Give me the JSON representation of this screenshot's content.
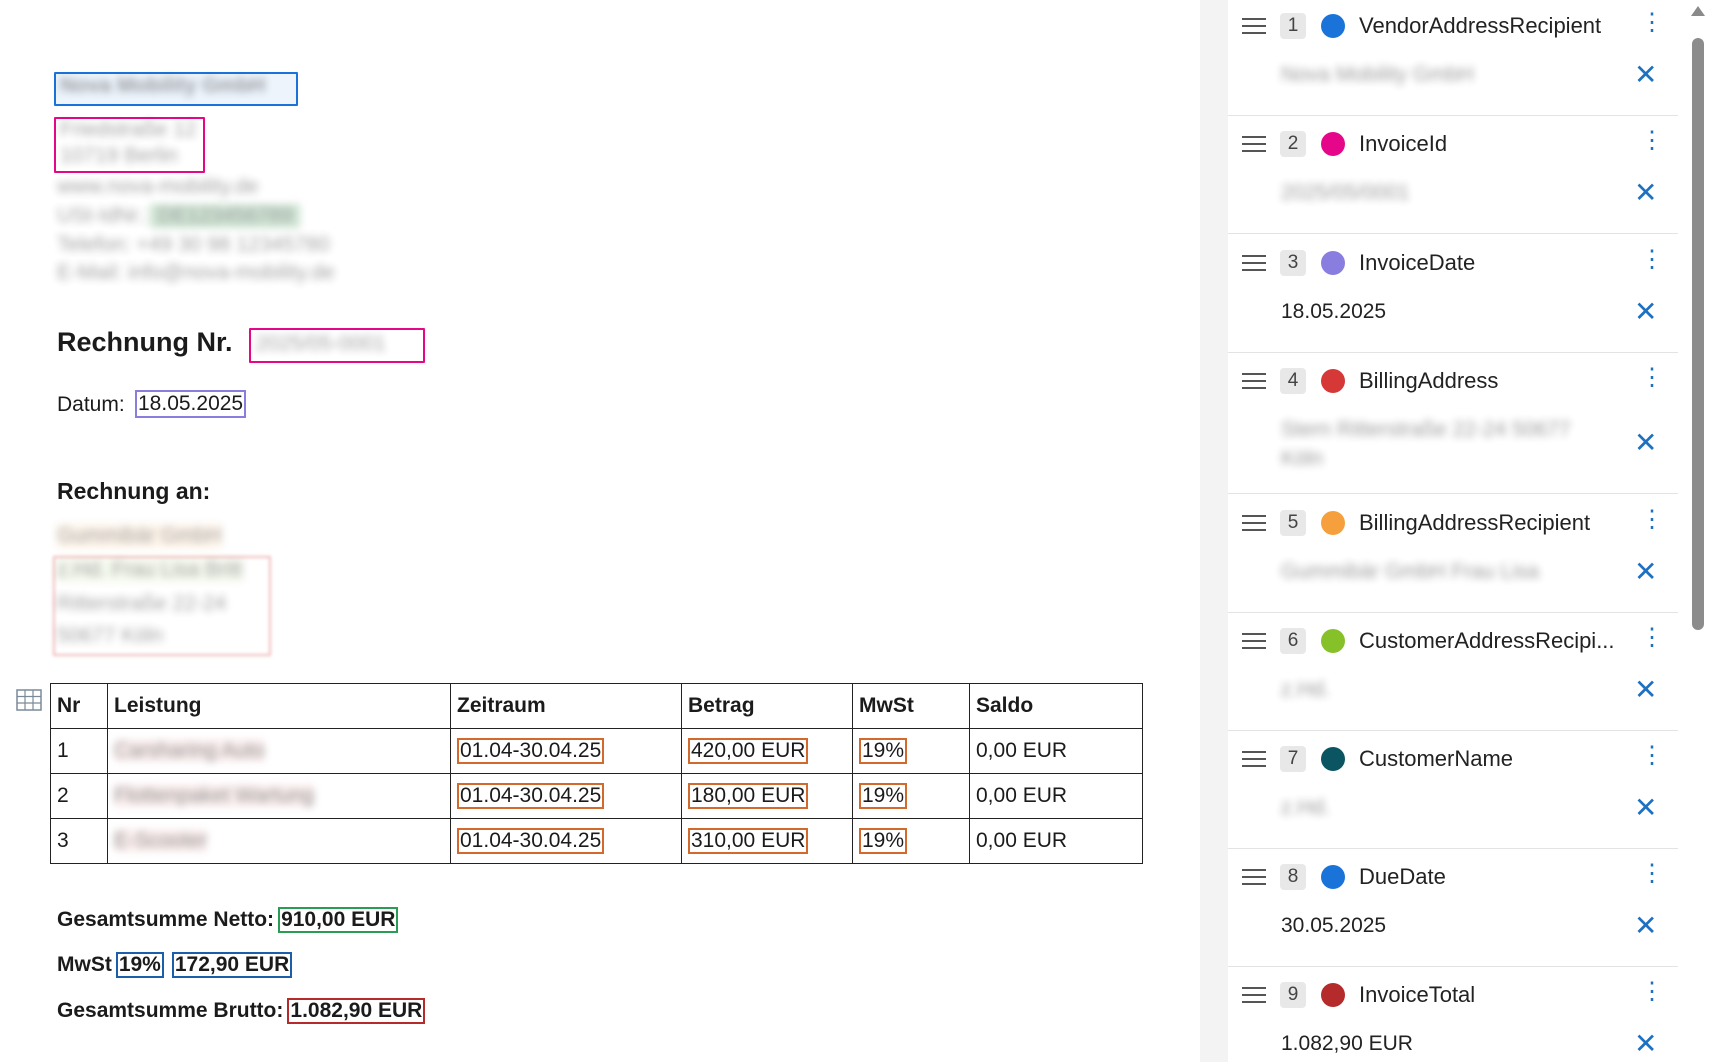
{
  "document": {
    "vendor_name": "Nova Mobility GmbH",
    "vendor_street": "Friedstraße 12",
    "vendor_city": "10719 Berlin",
    "vendor_web": "www.nova-mobility.de",
    "vendor_vat_label": "USt-IdNr.:",
    "vendor_vat": "DE123456789",
    "vendor_phone": "Telefon: +49 30 98 12345780",
    "vendor_email": "E-Mail: info@nova-mobility.de",
    "title": "Rechnung Nr.",
    "invoice_number": "2025/05-0001",
    "date_label": "Datum:",
    "date_value": "18.05.2025",
    "bill_to_label": "Rechnung an:",
    "customer_name": "Gummibär GmbH",
    "customer_contact": "z.Hd. Frau Lisa Britt",
    "customer_street": "Ritterstraße 22-24",
    "customer_city": "50677 Köln",
    "table": {
      "headers": [
        "Nr",
        "Leistung",
        "Zeitraum",
        "Betrag",
        "MwSt",
        "Saldo"
      ],
      "rows": [
        {
          "nr": "1",
          "service": "Carsharing Auto",
          "period": "01.04-30.04.25",
          "amount": "420,00 EUR",
          "vat": "19%",
          "balance": "0,00 EUR"
        },
        {
          "nr": "2",
          "service": "Flottenpaket Wartung",
          "period": "01.04-30.04.25",
          "amount": "180,00 EUR",
          "vat": "19%",
          "balance": "0,00 EUR"
        },
        {
          "nr": "3",
          "service": "E-Scooter",
          "period": "01.04-30.04.25",
          "amount": "310,00 EUR",
          "vat": "19%",
          "balance": "0,00 EUR"
        }
      ]
    },
    "net_label": "Gesamtsumme Netto:",
    "net_value": "910,00 EUR",
    "vat_label": "MwSt",
    "vat_rate": "19%",
    "vat_value": "172,90 EUR",
    "gross_label": "Gesamtsumme Brutto:",
    "gross_value": "1.082,90 EUR"
  },
  "fields": [
    {
      "index": "1",
      "name": "VendorAddressRecipient",
      "color": "#1a73d9",
      "value": "Nova Mobility GmbH",
      "blurred": true
    },
    {
      "index": "2",
      "name": "InvoiceId",
      "color": "#e6068a",
      "value": "2025/05/0001",
      "blurred": true
    },
    {
      "index": "3",
      "name": "InvoiceDate",
      "color": "#8a7de0",
      "value": "18.05.2025",
      "blurred": false
    },
    {
      "index": "4",
      "name": "BillingAddress",
      "color": "#d63838",
      "value": "Stern Ritterstraße 22-24 50677",
      "value2": "Köln",
      "blurred": true
    },
    {
      "index": "5",
      "name": "BillingAddressRecipient",
      "color": "#f5a03c",
      "value": "Gummibär GmbH Frau Lisa",
      "blurred": true
    },
    {
      "index": "6",
      "name": "CustomerAddressRecipi...",
      "color": "#86c12a",
      "value": "z.Hd.",
      "blurred": true
    },
    {
      "index": "7",
      "name": "CustomerName",
      "color": "#0b5563",
      "value": "z.Hd.",
      "blurred": true
    },
    {
      "index": "8",
      "name": "DueDate",
      "color": "#1a73d9",
      "value": "30.05.2025",
      "blurred": false
    },
    {
      "index": "9",
      "name": "InvoiceTotal",
      "color": "#b52a2a",
      "value": "1.082,90 EUR",
      "blurred": false
    }
  ],
  "icons": {
    "drag": "drag-handle-icon",
    "more": "more-vertical-icon",
    "close": "close-icon",
    "table": "table-icon"
  },
  "glyphs": {
    "more": "⋮",
    "close": "✕"
  },
  "colors": {
    "vendor_box": "#1a73d9",
    "invoice_id_box": "#e6068a",
    "date_box": "#8a7de0",
    "line_item_box": "#d2692d",
    "net_box": "#2a9d55",
    "vat_box": "#1a5fa8",
    "gross_box": "#b52a2a",
    "accent": "#1e70c1"
  }
}
